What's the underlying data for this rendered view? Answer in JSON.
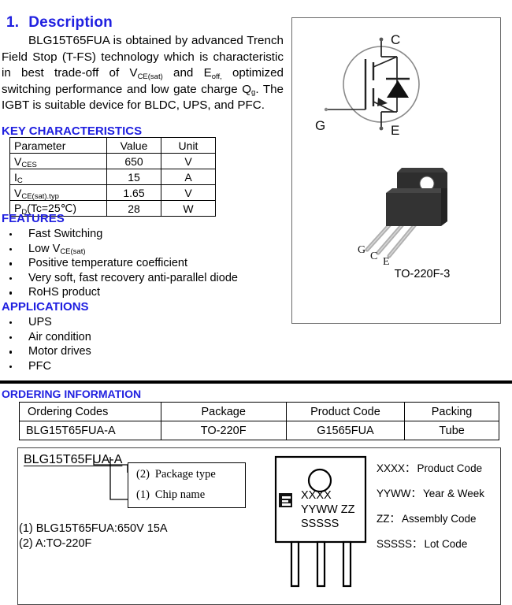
{
  "description": {
    "section_number": "1.",
    "heading": "Description",
    "paragraph_prefix": "BLG15T65FUA is obtained by advanced Trench Field Stop (T-FS) technology which is characteristic in best trade-off of V",
    "sub1": "CE(sat)",
    "mid1": " and E",
    "sub2": "off,",
    "mid2": " optimized switching performance and low gate charge Q",
    "sub3": "g",
    "tail": ". The IGBT is suitable device for BLDC, UPS, and PFC."
  },
  "key_characteristics": {
    "heading": "KEY CHARACTERISTICS",
    "columns": [
      "Parameter",
      "Value",
      "Unit"
    ],
    "rows": [
      {
        "param": "V",
        "param_sub": "CES",
        "param_tail": "",
        "value": "650",
        "unit": "V"
      },
      {
        "param": "I",
        "param_sub": "C",
        "param_tail": "",
        "value": "15",
        "unit": "A"
      },
      {
        "param": "V",
        "param_sub": "CE(sat).typ",
        "param_tail": "",
        "value": "1.65",
        "unit": "V"
      },
      {
        "param": "P",
        "param_sub": "D",
        "param_tail": "(Tc=25℃)",
        "value": "28",
        "unit": "W"
      }
    ]
  },
  "features": {
    "heading": "FEATURES",
    "items": [
      {
        "text": "Fast Switching",
        "sub": "",
        "tail": ""
      },
      {
        "text": "Low V",
        "sub": "CE(sat)",
        "tail": ""
      },
      {
        "text": "Positive temperature coefficient",
        "sub": "",
        "tail": ""
      },
      {
        "text": "Very soft, fast recovery anti-parallel diode",
        "sub": "",
        "tail": ""
      },
      {
        "text": "RoHS product",
        "sub": "",
        "tail": ""
      }
    ]
  },
  "applications": {
    "heading": "APPLICATIONS",
    "items": [
      {
        "text": "UPS",
        "sub": "",
        "tail": ""
      },
      {
        "text": "Air condition",
        "sub": "",
        "tail": ""
      },
      {
        "text": "Motor drives",
        "sub": "",
        "tail": ""
      },
      {
        "text": "PFC",
        "sub": "",
        "tail": ""
      }
    ]
  },
  "symbol_box": {
    "terminals": {
      "collector": "C",
      "gate": "G",
      "emitter": "E"
    },
    "package_pins": {
      "gate": "G",
      "collector": "C",
      "emitter": "E"
    },
    "package_label": "TO-220F-3",
    "body_color": "#3a3a3a",
    "lead_color": "#b9b9b9"
  },
  "ordering": {
    "heading": "ORDERING INFORMATION",
    "columns": [
      "Ordering Codes",
      "Package",
      "Product Code",
      "Packing"
    ],
    "rows": [
      {
        "ordering_code": "BLG15T65FUA-A",
        "package": "TO-220F",
        "product_code": "G1565FUA",
        "packing": "Tube"
      }
    ]
  },
  "part_number_breakdown": {
    "part_number": "BLG15T65FUA-A",
    "callouts": [
      {
        "index": "(2)",
        "label": "Package type"
      },
      {
        "index": "(1)",
        "label": "Chip name"
      }
    ],
    "legend": [
      "(1) BLG15T65FUA:650V 15A",
      "(2) A:TO-220F"
    ]
  },
  "marking": {
    "body_lines": [
      "XXXX",
      "YYWW  ZZ",
      "SSSSS"
    ],
    "legend": [
      {
        "key": "XXXX",
        "sep": "：",
        "label": "Product Code"
      },
      {
        "key": "YYWW",
        "sep": "：",
        "label": "Year & Week"
      },
      {
        "key": "ZZ",
        "sep": "：",
        "label": "Assembly Code"
      },
      {
        "key": "SSSSS",
        "sep": "：",
        "label": "Lot Code"
      }
    ]
  },
  "colors": {
    "heading_blue": "#2020e0",
    "rule_black": "#000000",
    "box_border": "#6a6a6a"
  }
}
